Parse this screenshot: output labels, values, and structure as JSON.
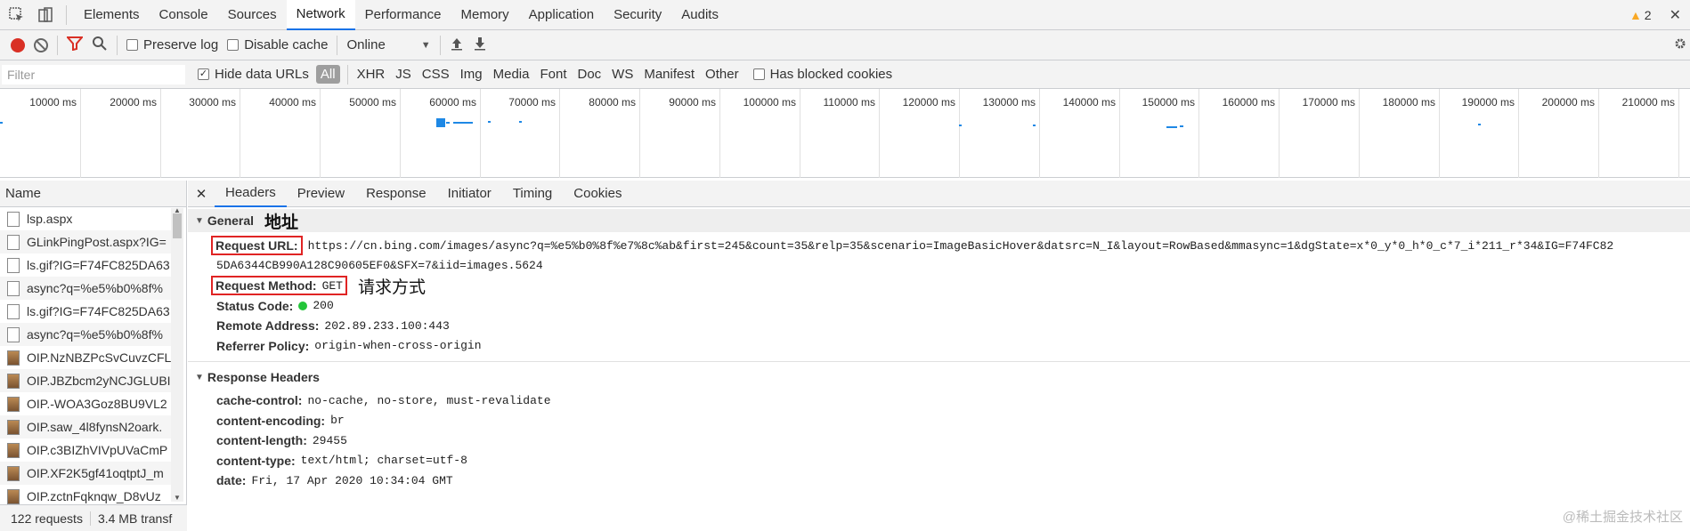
{
  "tabs": {
    "items": [
      {
        "label": "Elements"
      },
      {
        "label": "Console"
      },
      {
        "label": "Sources"
      },
      {
        "label": "Network"
      },
      {
        "label": "Performance"
      },
      {
        "label": "Memory"
      },
      {
        "label": "Application"
      },
      {
        "label": "Security"
      },
      {
        "label": "Audits"
      }
    ],
    "active": "Network",
    "warning_count": "2"
  },
  "toolbar": {
    "preserve_log": "Preserve log",
    "disable_cache": "Disable cache",
    "throttle": "Online"
  },
  "filterbar": {
    "placeholder": "Filter",
    "hide_data_urls": "Hide data URLs",
    "types": [
      "All",
      "XHR",
      "JS",
      "CSS",
      "Img",
      "Media",
      "Font",
      "Doc",
      "WS",
      "Manifest",
      "Other"
    ],
    "active_type": "All",
    "blocked_cookies": "Has blocked cookies"
  },
  "overview": {
    "ticks": [
      "10000 ms",
      "20000 ms",
      "30000 ms",
      "40000 ms",
      "50000 ms",
      "60000 ms",
      "70000 ms",
      "80000 ms",
      "90000 ms",
      "100000 ms",
      "110000 ms",
      "120000 ms",
      "130000 ms",
      "140000 ms",
      "150000 ms",
      "160000 ms",
      "170000 ms",
      "180000 ms",
      "190000 ms",
      "200000 ms",
      "210000 ms"
    ]
  },
  "namepanel": {
    "header": "Name",
    "rows": [
      {
        "name": "lsp.aspx",
        "icon": "doc"
      },
      {
        "name": "GLinkPingPost.aspx?IG=",
        "icon": "doc"
      },
      {
        "name": "ls.gif?IG=F74FC825DA63",
        "icon": "doc"
      },
      {
        "name": "async?q=%e5%b0%8f%",
        "icon": "doc"
      },
      {
        "name": "ls.gif?IG=F74FC825DA63",
        "icon": "doc"
      },
      {
        "name": "async?q=%e5%b0%8f%",
        "icon": "doc"
      },
      {
        "name": "OIP.NzNBZPcSvCuvzCFL",
        "icon": "img"
      },
      {
        "name": "OIP.JBZbcm2yNCJGLUBI",
        "icon": "img"
      },
      {
        "name": "OIP.-WOA3Goz8BU9VL2",
        "icon": "img"
      },
      {
        "name": "OIP.saw_4l8fynsN2oark.",
        "icon": "img"
      },
      {
        "name": "OIP.c3BIZhVIVpUVaCmP",
        "icon": "img"
      },
      {
        "name": "OIP.XF2K5gf41oqtptJ_m",
        "icon": "img"
      },
      {
        "name": "OIP.zctnFqknqw_D8vUz",
        "icon": "img"
      }
    ],
    "requests": "122 requests",
    "transferred": "3.4 MB transf"
  },
  "detail": {
    "tabs": [
      "Headers",
      "Preview",
      "Response",
      "Initiator",
      "Timing",
      "Cookies"
    ],
    "active_tab": "Headers",
    "general": {
      "title": "General",
      "annotation": "地址",
      "request_url_key": "Request URL:",
      "request_url_value": "https://cn.bing.com/images/async?q=%e5%b0%8f%e7%8c%ab&first=245&count=35&relp=35&scenario=ImageBasicHover&datsrc=N_I&layout=RowBased&mmasync=1&dgState=x*0_y*0_h*0_c*7_i*211_r*34&IG=F74FC82",
      "request_url_value_2": "5DA6344CB990A128C90605EF0&SFX=7&iid=images.5624",
      "request_method_key": "Request Method:",
      "request_method_value": "GET",
      "method_annotation": "请求方式",
      "status_code_key": "Status Code:",
      "status_code_value": "200",
      "remote_address_key": "Remote Address:",
      "remote_address_value": "202.89.233.100:443",
      "referrer_policy_key": "Referrer Policy:",
      "referrer_policy_value": "origin-when-cross-origin"
    },
    "response_headers": {
      "title": "Response Headers",
      "items": [
        {
          "key": "cache-control:",
          "value": "no-cache, no-store, must-revalidate"
        },
        {
          "key": "content-encoding:",
          "value": "br"
        },
        {
          "key": "content-length:",
          "value": "29455"
        },
        {
          "key": "content-type:",
          "value": "text/html; charset=utf-8"
        },
        {
          "key": "date:",
          "value": "Fri, 17 Apr 2020 10:34:04 GMT"
        }
      ]
    }
  },
  "watermark": "@稀土掘金技术社区"
}
